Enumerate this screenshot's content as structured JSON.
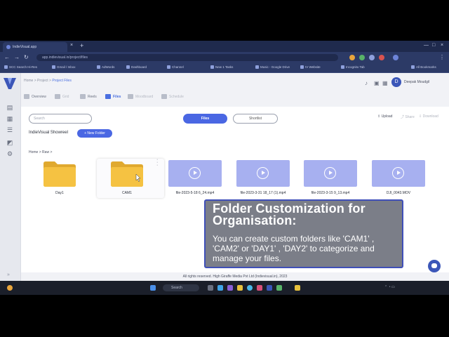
{
  "browser": {
    "tab_title": "IndieVisual.app",
    "tab_close": "×",
    "tab_new": "+",
    "url": "app.indievisual.in/project/files",
    "bookmarks": [
      "SCC Search Hi-Res",
      "Gmail / Inbox",
      "AdWords",
      "Dashboard",
      "Channel",
      "New 1 Tasks",
      "Music - Google Drive",
      "IV Website",
      "Incognito Tab",
      "All Bookmarks"
    ]
  },
  "sidebar": {
    "icons": [
      "wallet-icon",
      "calendar-icon",
      "list-icon",
      "megaphone-icon",
      "gear-icon"
    ],
    "collapse": "»"
  },
  "header": {
    "breadcrumb_home": "Home",
    "breadcrumb_project": "Project",
    "breadcrumb_current": "Project Files",
    "user_initial": "D",
    "user_name": "Deepak Moudgil",
    "tabs": [
      {
        "label": "Overview"
      },
      {
        "label": "Grid"
      },
      {
        "label": "Reels"
      },
      {
        "label": "Files"
      },
      {
        "label": "Moodboard"
      },
      {
        "label": "Schedule"
      }
    ]
  },
  "toolbar": {
    "search_placeholder": "Search",
    "files_label": "Files",
    "shortlist_label": "Shortlist",
    "upload_label": "Upload",
    "share_label": "Share",
    "download_label": "Download"
  },
  "project": {
    "name": "IndieVisual Showreel",
    "new_folder_label": "+ New Folder",
    "path_home": "Home",
    "path_raw": "Raw",
    "sep": ">"
  },
  "items": {
    "folders": [
      {
        "name": "Day1"
      },
      {
        "name": "CAM1"
      }
    ],
    "videos": [
      {
        "name": "file-2023-5-18 6_24.mp4"
      },
      {
        "name": "file-2023-3-31 18_17 (1).mp4"
      },
      {
        "name": "file-2023-3-15 9_13.mp4"
      },
      {
        "name": "DJI_0043.MOV"
      }
    ]
  },
  "footer": {
    "text": "All rights reserved. High Giraffe Media Pvt Ltd (Indievisual.in), 2023"
  },
  "callout": {
    "title": "Folder Customization for Organisation:",
    "body": "You can create custom folders like 'CAM1' , 'CAM2' or 'DAY1' , 'DAY2' to categorize and manage your files."
  },
  "taskbar": {
    "search_label": "Search"
  },
  "colors": {
    "accent": "#4a67e3",
    "folder": "#f5c242",
    "video_thumb": "#a7b0f0",
    "callout_border": "#3f4fb8"
  }
}
